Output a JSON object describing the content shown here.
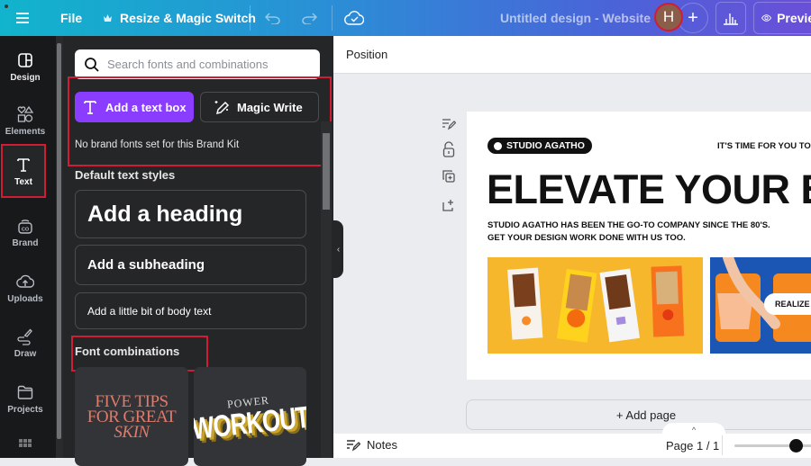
{
  "topbar": {
    "file_label": "File",
    "resize_label": "Resize & Magic Switch",
    "design_title": "Untitled design - Website",
    "avatar_initial": "H",
    "preview_label": "Preview",
    "icons": [
      "hamburger-menu-icon",
      "crown-icon",
      "undo-icon",
      "redo-icon",
      "cloud-saved-icon",
      "plus-icon",
      "insights-chart-icon",
      "eye-icon"
    ]
  },
  "siderail": {
    "items": [
      {
        "label": "Design",
        "icon": "design-layout-icon"
      },
      {
        "label": "Elements",
        "icon": "shapes-icon"
      },
      {
        "label": "Text",
        "icon": "text-T-icon",
        "active": true
      },
      {
        "label": "Brand",
        "icon": "brand-kit-icon"
      },
      {
        "label": "Uploads",
        "icon": "cloud-upload-icon"
      },
      {
        "label": "Draw",
        "icon": "pen-draw-icon"
      },
      {
        "label": "Projects",
        "icon": "folder-icon"
      },
      {
        "label": "",
        "icon": "apps-grid-icon"
      }
    ]
  },
  "panel": {
    "search_placeholder": "Search fonts and combinations",
    "search_value": "",
    "add_textbox_label": "Add a text box",
    "magic_write_label": "Magic Write",
    "no_brand_fonts": "No brand fonts set for this Brand Kit",
    "default_styles_label": "Default text styles",
    "heading_label": "Add a heading",
    "subheading_label": "Add a subheading",
    "body_label": "Add a little bit of body text",
    "font_combinations_label": "Font combinations",
    "combo1": {
      "line1": "FIVE TIPS",
      "line2": "FOR GREAT",
      "line3": "SKIN",
      "color": "#e07a6a"
    },
    "combo2": {
      "line1": "POWER",
      "line2": "WORKOUT",
      "color": "#f5e04a"
    }
  },
  "editor": {
    "position_label": "Position",
    "canvas": {
      "brand_pill": "STUDIO AGATHO",
      "tagline": "IT'S TIME FOR YOU TO",
      "headline": "ELEVATE YOUR B",
      "sub_line1": "STUDIO AGATHO HAS BEEN THE GO-TO COMPANY SINCE THE 80'S.",
      "sub_line2": "GET YOUR DESIGN WORK DONE WITH US TOO.",
      "photo_button": "REALIZE T"
    },
    "add_page_label": "+ Add page",
    "notes_label": "Notes",
    "page_indicator": "Page 1 / 1",
    "zoom_fraction": 0.68
  },
  "colors": {
    "accent_purple": "#8b3dff",
    "highlight_red": "#d01d33",
    "panel_bg": "#252627",
    "rail_bg": "#18191b"
  }
}
